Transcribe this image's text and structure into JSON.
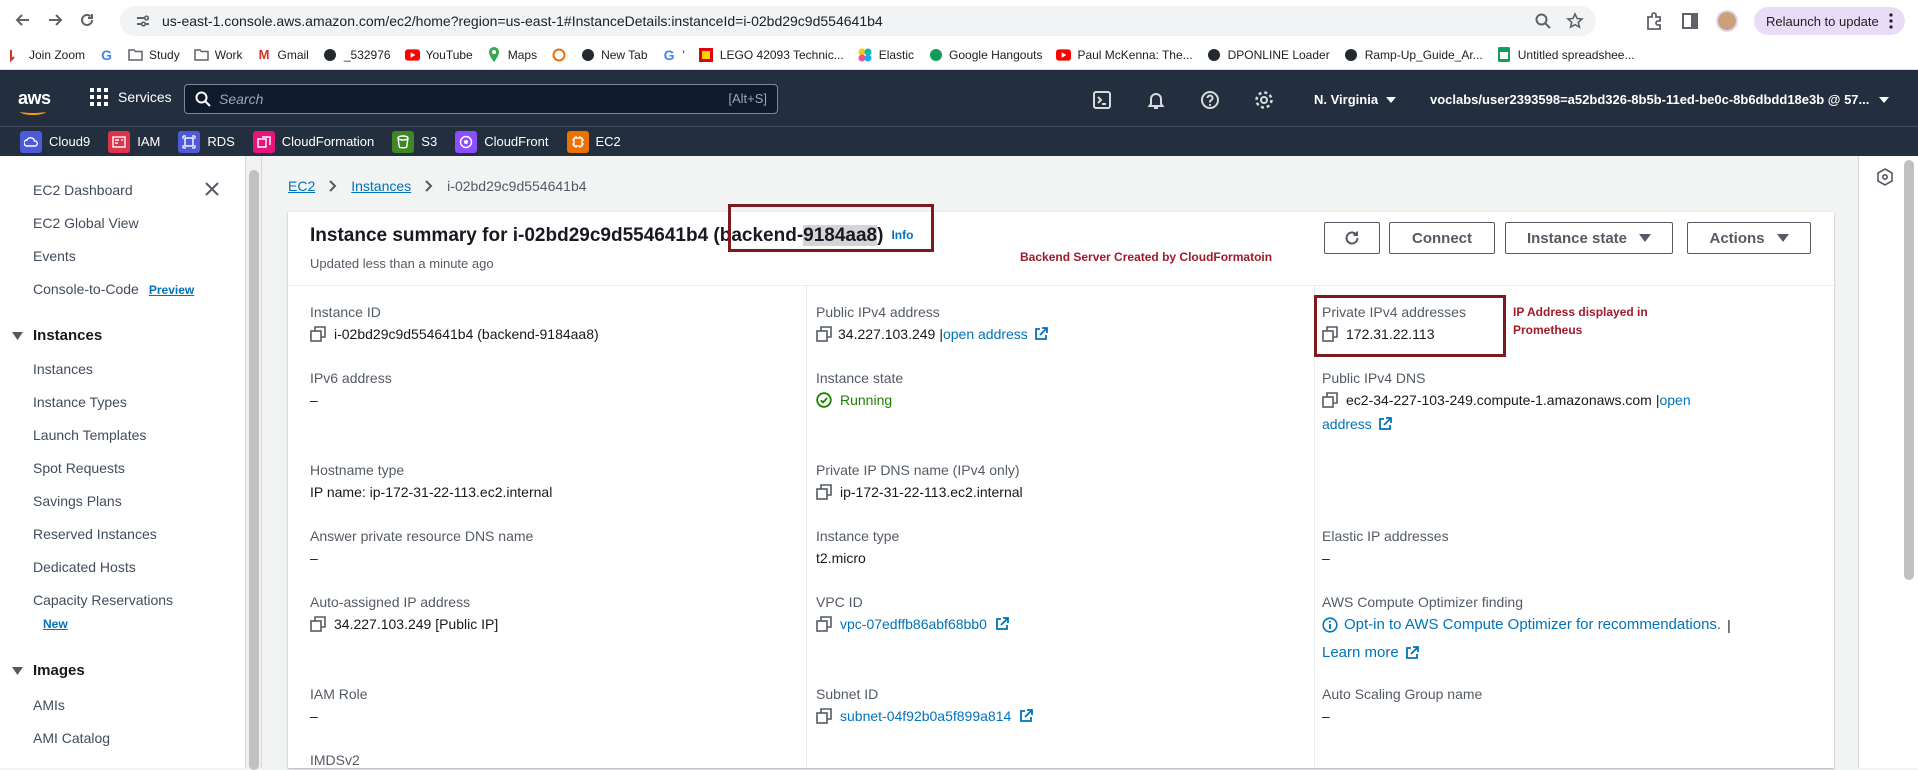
{
  "browser": {
    "url": "us-east-1.console.aws.amazon.com/ec2/home?region=us-east-1#InstanceDetails:instanceId=i-02bd29c9d554641b4",
    "relaunch_label": "Relaunch to update",
    "bookmarks": [
      "Join Zoom",
      "Study",
      "Work",
      "Gmail",
      "_532976",
      "YouTube",
      "Maps",
      "New Tab",
      "'",
      "LEGO 42093 Technic...",
      "Elastic",
      "Google Hangouts",
      "Paul McKenna: The...",
      "DPONLINE Loader",
      "Ramp-Up_Guide_Ar...",
      "Untitled spreadshee..."
    ]
  },
  "aws": {
    "logo": "aws",
    "services_label": "Services",
    "search_placeholder": "Search",
    "search_shortcut": "[Alt+S]",
    "region": "N. Virginia",
    "account": "voclabs/user2393598=a52bd326-8b5b-11ed-be0c-8b6dbdd18e3b @ 57...",
    "favorites": [
      {
        "label": "Cloud9",
        "color": "#4d5bd9"
      },
      {
        "label": "IAM",
        "color": "#dd344c"
      },
      {
        "label": "RDS",
        "color": "#4d5bd9"
      },
      {
        "label": "CloudFormation",
        "color": "#e7157b"
      },
      {
        "label": "S3",
        "color": "#3f8624"
      },
      {
        "label": "CloudFront",
        "color": "#8c4fff"
      },
      {
        "label": "EC2",
        "color": "#ed7100"
      }
    ]
  },
  "sidebar": {
    "top_items": [
      "EC2 Dashboard",
      "EC2 Global View",
      "Events",
      "Console-to-Code"
    ],
    "console_badge": "Preview",
    "section_instances": "Instances",
    "instances_items": [
      "Instances",
      "Instance Types",
      "Launch Templates",
      "Spot Requests",
      "Savings Plans",
      "Reserved Instances",
      "Dedicated Hosts",
      "Capacity Reservations"
    ],
    "capacity_badge": "New",
    "section_images": "Images",
    "images_items": [
      "AMIs",
      "AMI Catalog"
    ]
  },
  "breadcrumb": [
    "EC2",
    "Instances",
    "i-02bd29c9d554641b4"
  ],
  "summary": {
    "title_prefix": "Instance summary for i-02bd29c9d554641b4 (backend-",
    "title_highlight": "9184aa8",
    "title_suffix": ")",
    "info": "Info",
    "updated": "Updated less than a minute ago",
    "annotation_backend": "Backend Server Created by CloudFormatoin",
    "annotation_ip": "IP Address displayed in Prometheus",
    "buttons": {
      "connect": "Connect",
      "instance_state": "Instance state",
      "actions": "Actions"
    }
  },
  "details": {
    "instance_id_label": "Instance ID",
    "instance_id": "i-02bd29c9d554641b4 (backend-9184aa8)",
    "public_ipv4_label": "Public IPv4 address",
    "public_ipv4": "34.227.103.249",
    "open_address": "open address",
    "private_ipv4_label": "Private IPv4 addresses",
    "private_ipv4": "172.31.22.113",
    "ipv6_label": "IPv6 address",
    "ipv6": "–",
    "instance_state_label": "Instance state",
    "instance_state": "Running",
    "public_dns_label": "Public IPv4 DNS",
    "public_dns": "ec2-34-227-103-249.compute-1.amazonaws.com",
    "open_address_part1": "open",
    "open_address_part2": "address",
    "hostname_type_label": "Hostname type",
    "hostname_type": "IP name: ip-172-31-22-113.ec2.internal",
    "private_dns_label": "Private IP DNS name (IPv4 only)",
    "private_dns": "ip-172-31-22-113.ec2.internal",
    "answer_dns_label": "Answer private resource DNS name",
    "answer_dns": "–",
    "instance_type_label": "Instance type",
    "instance_type": "t2.micro",
    "elastic_ip_label": "Elastic IP addresses",
    "elastic_ip": "–",
    "auto_ip_label": "Auto-assigned IP address",
    "auto_ip": "34.227.103.249 [Public IP]",
    "vpc_label": "VPC ID",
    "vpc": "vpc-07edffb86abf68bb0",
    "optimizer_label": "AWS Compute Optimizer finding",
    "optimizer_link": "Opt-in to AWS Compute Optimizer for recommendations.",
    "learn_more": "Learn more",
    "iam_label": "IAM Role",
    "iam": "–",
    "subnet_label": "Subnet ID",
    "subnet": "subnet-04f92b0a5f899a814",
    "asg_label": "Auto Scaling Group name",
    "asg": "–",
    "imds_label": "IMDSv2"
  }
}
